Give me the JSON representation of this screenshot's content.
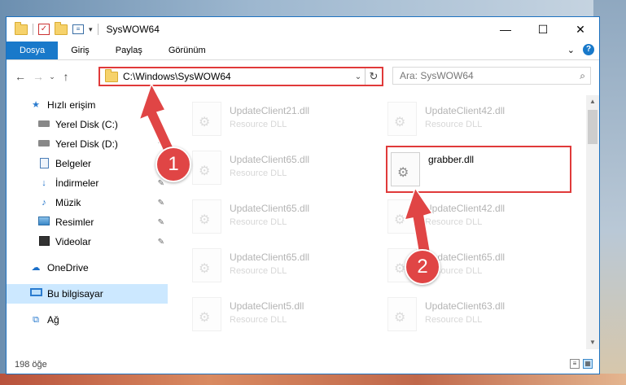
{
  "window": {
    "title": "SysWOW64",
    "controls": {
      "minimize": "—",
      "maximize": "☐",
      "close": "✕"
    }
  },
  "ribbon": {
    "tabs": [
      "Dosya",
      "Giriş",
      "Paylaş",
      "Görünüm"
    ],
    "help": "?"
  },
  "address": {
    "path": "C:\\Windows\\SysWOW64",
    "search_placeholder": "Ara: SysWOW64"
  },
  "sidebar": {
    "quick_access": "Hızlı erişim",
    "items": [
      "Yerel Disk (C:)",
      "Yerel Disk (D:)",
      "Belgeler",
      "İndirmeler",
      "Müzik",
      "Resimler",
      "Videolar"
    ],
    "onedrive": "OneDrive",
    "this_pc": "Bu bilgisayar",
    "network": "Ağ"
  },
  "files": [
    {
      "name": "UpdateClient21.dll",
      "type": "Resource DLL"
    },
    {
      "name": "UpdateClient42.dll",
      "type": "Resource DLL"
    },
    {
      "name": "UpdateClient65.dll",
      "type": "Resource DLL"
    },
    {
      "name": "grabber.dll",
      "type": ""
    },
    {
      "name": "UpdateClient65.dll",
      "type": "Resource DLL"
    },
    {
      "name": "UpdateClient42.dll",
      "type": "Resource DLL"
    },
    {
      "name": "UpdateClient65.dll",
      "type": "Resource DLL"
    },
    {
      "name": "UpdateClient65.dll",
      "type": "Resource DLL"
    },
    {
      "name": "UpdateClient5.dll",
      "type": "Resource DLL"
    },
    {
      "name": "UpdateClient63.dll",
      "type": "Resource DLL"
    }
  ],
  "status": {
    "count": "198 öğe"
  },
  "callouts": [
    "1",
    "2"
  ],
  "colors": {
    "accent": "#1979ca",
    "highlight": "#e03a3a",
    "selected": "#cce8ff"
  }
}
